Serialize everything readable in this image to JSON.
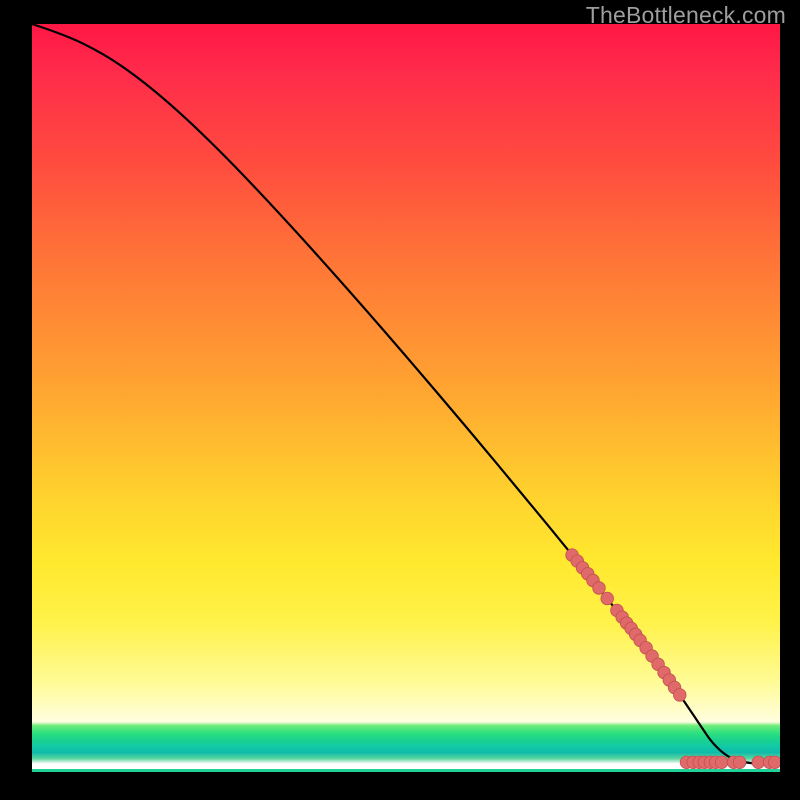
{
  "watermark": {
    "text": "TheBottleneck.com"
  },
  "colors": {
    "curve": "#000000",
    "marker_fill": "#e06a6a",
    "marker_stroke": "#c14f4f"
  },
  "chart_data": {
    "type": "line",
    "title": "",
    "xlabel": "",
    "ylabel": "",
    "xlim": [
      0,
      100
    ],
    "ylim": [
      0,
      100
    ],
    "grid": false,
    "legend": false,
    "annotations": [],
    "series": [
      {
        "name": "curve",
        "x": [
          0,
          3,
          7,
          12,
          18,
          25,
          33,
          42,
          50,
          58,
          66,
          72,
          78,
          82,
          85,
          87.5,
          89.5,
          91,
          93,
          95,
          97,
          100
        ],
        "y": [
          100,
          99,
          97.4,
          94.5,
          89.8,
          83.2,
          74.8,
          64.8,
          55.6,
          46.2,
          36.6,
          29.3,
          21.8,
          16.8,
          12.6,
          9.0,
          6.0,
          3.8,
          2.0,
          1.3,
          1.1,
          1.05
        ]
      }
    ],
    "markers": [
      {
        "x": 72.2,
        "y": 29.0
      },
      {
        "x": 72.9,
        "y": 28.2
      },
      {
        "x": 73.6,
        "y": 27.3
      },
      {
        "x": 74.3,
        "y": 26.5
      },
      {
        "x": 75.0,
        "y": 25.6
      },
      {
        "x": 75.8,
        "y": 24.6
      },
      {
        "x": 76.9,
        "y": 23.2
      },
      {
        "x": 78.2,
        "y": 21.6
      },
      {
        "x": 78.9,
        "y": 20.7
      },
      {
        "x": 79.5,
        "y": 19.9
      },
      {
        "x": 80.1,
        "y": 19.2
      },
      {
        "x": 80.7,
        "y": 18.4
      },
      {
        "x": 81.3,
        "y": 17.6
      },
      {
        "x": 82.1,
        "y": 16.6
      },
      {
        "x": 82.9,
        "y": 15.5
      },
      {
        "x": 83.7,
        "y": 14.4
      },
      {
        "x": 84.5,
        "y": 13.3
      },
      {
        "x": 85.2,
        "y": 12.3
      },
      {
        "x": 85.9,
        "y": 11.3
      },
      {
        "x": 86.6,
        "y": 10.3
      },
      {
        "x": 87.5,
        "y": 1.3
      },
      {
        "x": 88.4,
        "y": 1.3
      },
      {
        "x": 89.2,
        "y": 1.3
      },
      {
        "x": 89.9,
        "y": 1.3
      },
      {
        "x": 90.7,
        "y": 1.3
      },
      {
        "x": 91.4,
        "y": 1.3
      },
      {
        "x": 92.2,
        "y": 1.3
      },
      {
        "x": 93.8,
        "y": 1.3
      },
      {
        "x": 94.6,
        "y": 1.3
      },
      {
        "x": 97.1,
        "y": 1.3
      },
      {
        "x": 98.6,
        "y": 1.3
      },
      {
        "x": 99.3,
        "y": 1.3
      }
    ]
  }
}
